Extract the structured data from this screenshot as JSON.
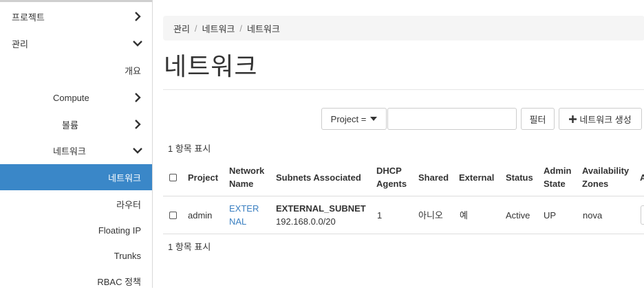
{
  "sidebar": {
    "items": [
      {
        "label": "프로젝트",
        "chevron": "right"
      },
      {
        "label": "관리",
        "chevron": "down"
      },
      {
        "label": "개요"
      },
      {
        "label": "Compute",
        "chevron": "right"
      },
      {
        "label": "볼륨",
        "chevron": "right"
      },
      {
        "label": "네트워크",
        "chevron": "down"
      },
      {
        "label": "네트워크",
        "active": true
      },
      {
        "label": "라우터"
      },
      {
        "label": "Floating IP"
      },
      {
        "label": "Trunks"
      },
      {
        "label": "RBAC 정책"
      }
    ]
  },
  "breadcrumb": {
    "items": [
      "관리",
      "네트워크",
      "네트워크"
    ]
  },
  "page": {
    "title": "네트워크"
  },
  "toolbar": {
    "filter_field_label": "Project =",
    "search_value": "",
    "filter_button": "필터",
    "create_button": "+ 네트워크 생성",
    "create_label": "네트워크 생성"
  },
  "table": {
    "count_top": "1 항목 표시",
    "count_bottom": "1 항목 표시",
    "headers": {
      "project": "Project",
      "network_name_1": "Network",
      "network_name_2": "Name",
      "subnets": "Subnets Associated",
      "dhcp_1": "DHCP",
      "dhcp_2": "Agents",
      "shared": "Shared",
      "external": "External",
      "status": "Status",
      "admin_1": "Admin",
      "admin_2": "State",
      "az_1": "Availability",
      "az_2": "Zones",
      "actions_partial": "A"
    },
    "rows": [
      {
        "project": "admin",
        "name_line1": "EXTER",
        "name_line2": "NAL",
        "subnet_name": "EXTERNAL_SUBNET",
        "subnet_cidr": "192.168.0.0/20",
        "dhcp_agents": "1",
        "shared": "아니오",
        "external": "예",
        "status": "Active",
        "admin_state": "UP",
        "az": "nova"
      }
    ]
  },
  "colors": {
    "active_bg": "#3a87c8",
    "link": "#3a7fc1"
  }
}
